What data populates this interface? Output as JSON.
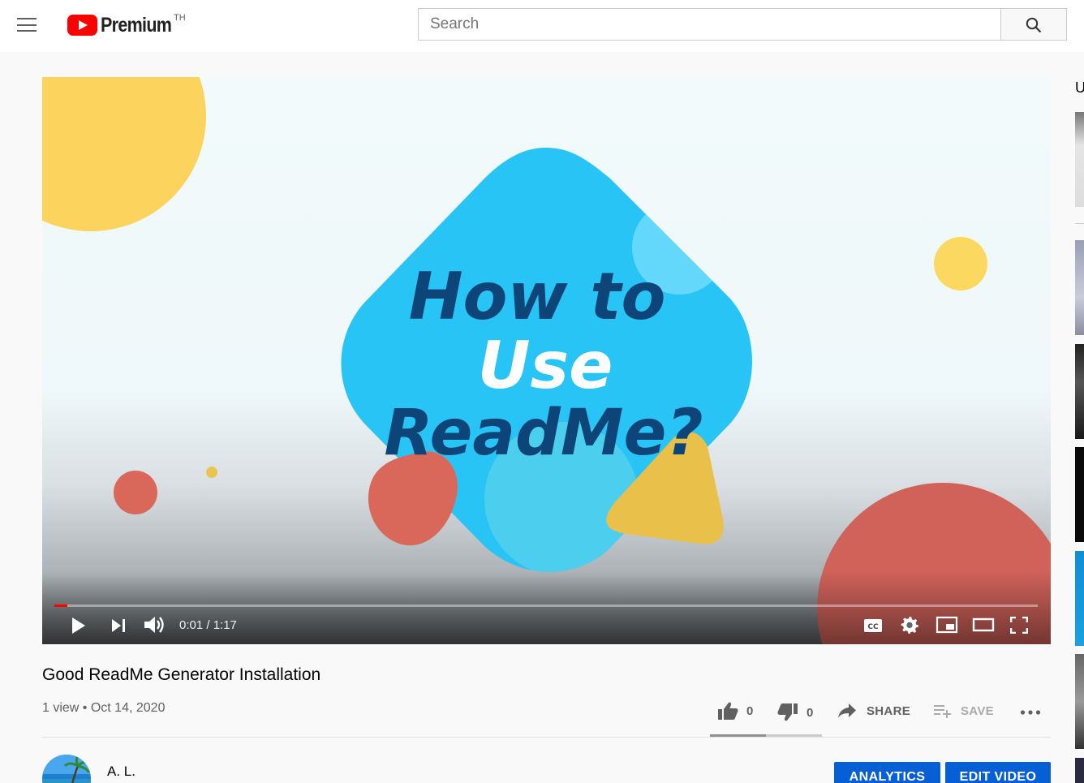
{
  "header": {
    "logo_text": "Premium",
    "country_code": "TH",
    "search_placeholder": "Search",
    "icons": [
      "menu-icon",
      "youtube-play-icon",
      "search-icon"
    ]
  },
  "player": {
    "overlay_text": [
      "How to",
      "Use",
      "ReadMe?"
    ],
    "time": "0:01 / 1:17",
    "progress_fraction": 0.0129,
    "icons": [
      "play-icon",
      "next-icon",
      "volume-icon",
      "captions-icon",
      "settings-icon",
      "miniplayer-icon",
      "theater-icon",
      "fullscreen-icon"
    ]
  },
  "video": {
    "title": "Good ReadMe Generator Installation",
    "meta": "1 view • Oct 14, 2020"
  },
  "actions": {
    "like_count": "0",
    "dislike_count": "0",
    "share_label": "SHARE",
    "save_label": "SAVE",
    "like_fraction": 0.5
  },
  "owner": {
    "name": "A. L.",
    "analytics_label": "ANALYTICS",
    "edit_label": "EDIT VIDEO"
  },
  "sidebar": {
    "heading_fragment": "U"
  },
  "colors": {
    "brand_red": "#ff0000",
    "button_blue": "#065fd4",
    "diamond_blue": "#28c4f5",
    "text_navy": "#0d4579",
    "sun_yellow": "#fbd35d",
    "coral": "#d9685b"
  }
}
